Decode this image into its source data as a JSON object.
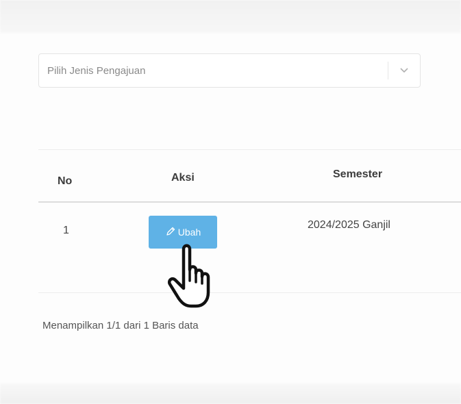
{
  "filter": {
    "placeholder": "Pilih Jenis Pengajuan",
    "arrow_icon": "chevron-down-icon"
  },
  "table": {
    "columns": [
      "No",
      "Aksi",
      "Semester"
    ],
    "rows": [
      {
        "no": "1",
        "action_label": "Ubah",
        "action_icon": "pencil-icon",
        "semester": "2024/2025 Ganjil"
      }
    ]
  },
  "pagination": {
    "info": "Menampilkan 1/1 dari 1 Baris data"
  },
  "colors": {
    "edit_button": "#5fb2e6",
    "background": "#fdfdfd"
  },
  "cursor": {
    "icon": "hand-pointer-icon"
  }
}
